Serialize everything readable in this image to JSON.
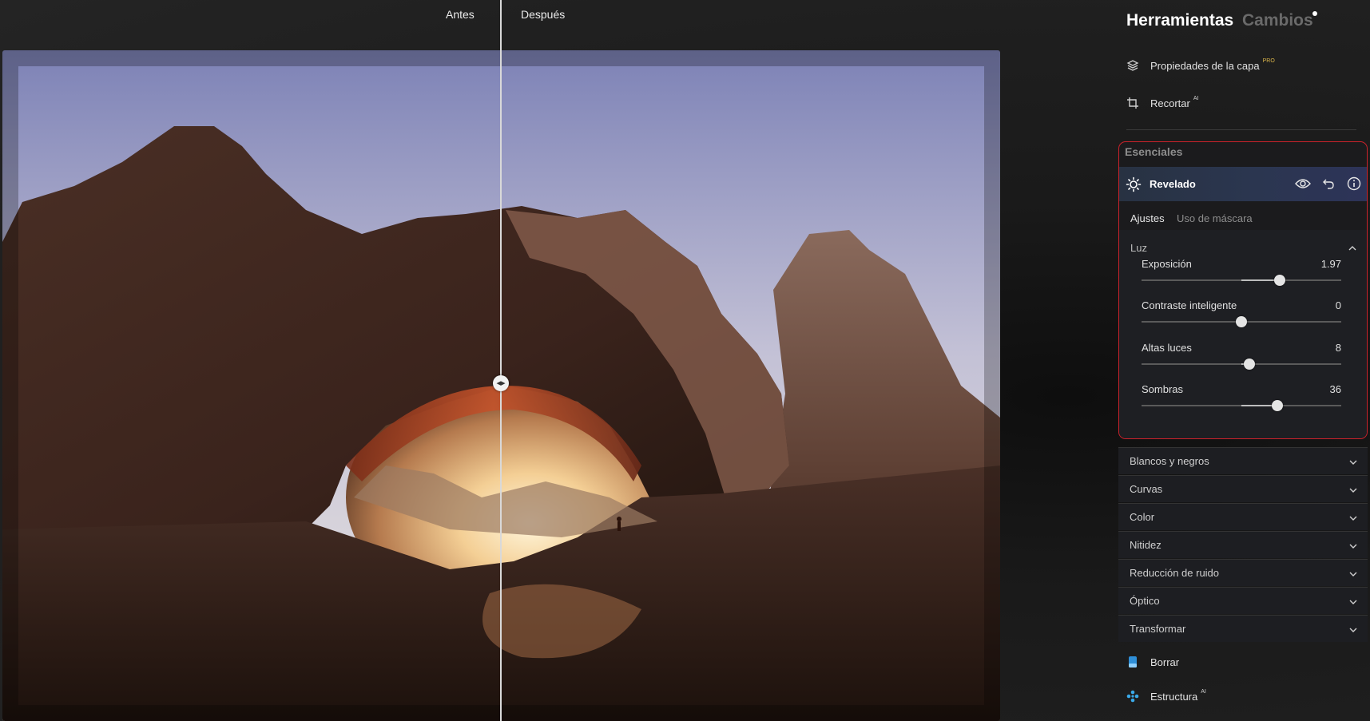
{
  "compare": {
    "before_label": "Antes",
    "after_label": "Después"
  },
  "panel": {
    "tabs": {
      "tools": "Herramientas",
      "changes": "Cambios"
    },
    "layer_properties": {
      "label": "Propiedades de la capa",
      "badge": "PRO"
    },
    "crop": {
      "label": "Recortar",
      "badge": "AI"
    },
    "essentials": {
      "title": "Esenciales",
      "revelado": {
        "label": "Revelado"
      },
      "subtabs": {
        "adjust": "Ajustes",
        "mask": "Uso de máscara"
      },
      "luz": {
        "title": "Luz",
        "sliders": [
          {
            "label": "Exposición",
            "value": "1.97",
            "fraction": 0.69
          },
          {
            "label": "Contraste inteligente",
            "value": "0",
            "fraction": 0.5
          },
          {
            "label": "Altas luces",
            "value": "8",
            "fraction": 0.54
          },
          {
            "label": "Sombras",
            "value": "36",
            "fraction": 0.68
          }
        ]
      }
    },
    "sections": [
      "Blancos y negros",
      "Curvas",
      "Color",
      "Nitidez",
      "Reducción de ruido",
      "Óptico",
      "Transformar"
    ],
    "erase": {
      "label": "Borrar"
    },
    "structure": {
      "label": "Estructura",
      "badge": "AI"
    }
  },
  "colors": {
    "highlight_border": "#c9222b",
    "revelado_bar": "#2b3650",
    "pro_badge": "#d9b44a",
    "erase_icon": "#2f8fd8",
    "structure_icon": "#3aa9e8"
  }
}
